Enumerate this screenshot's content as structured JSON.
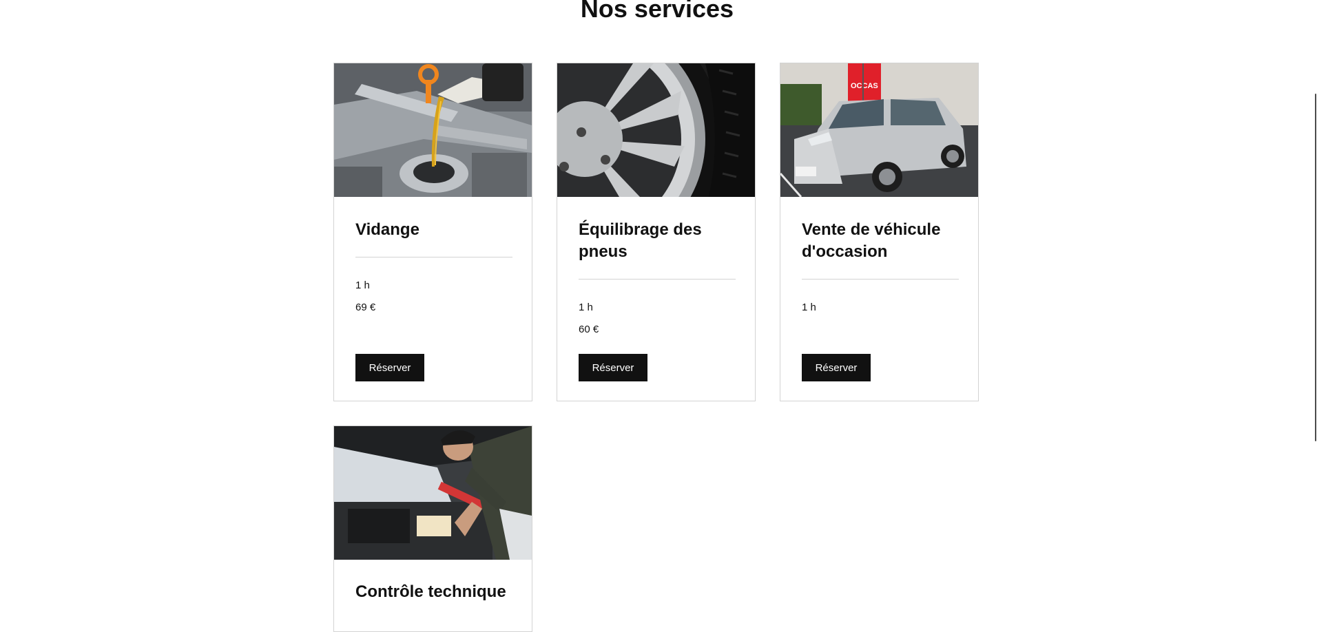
{
  "page": {
    "title": "Nos services"
  },
  "services": [
    {
      "name": "Vidange",
      "duration": "1 h",
      "price": "69 €",
      "button_label": "Réserver",
      "image_icon": "oil-change-photo"
    },
    {
      "name": "Équilibrage des pneus",
      "duration": "1 h",
      "price": "60 €",
      "button_label": "Réserver",
      "image_icon": "tire-wheel-photo"
    },
    {
      "name": "Vente de véhicule d'occasion",
      "duration": "1 h",
      "price": "",
      "button_label": "Réserver",
      "image_icon": "used-car-photo",
      "image_sign_text": "OCCAS"
    },
    {
      "name": "Contrôle technique",
      "image_icon": "mechanic-inspection-photo"
    }
  ],
  "colors": {
    "button_bg": "#111111",
    "button_text": "#ffffff",
    "card_border": "#d3d3d3",
    "divider": "#d3d3d3"
  }
}
